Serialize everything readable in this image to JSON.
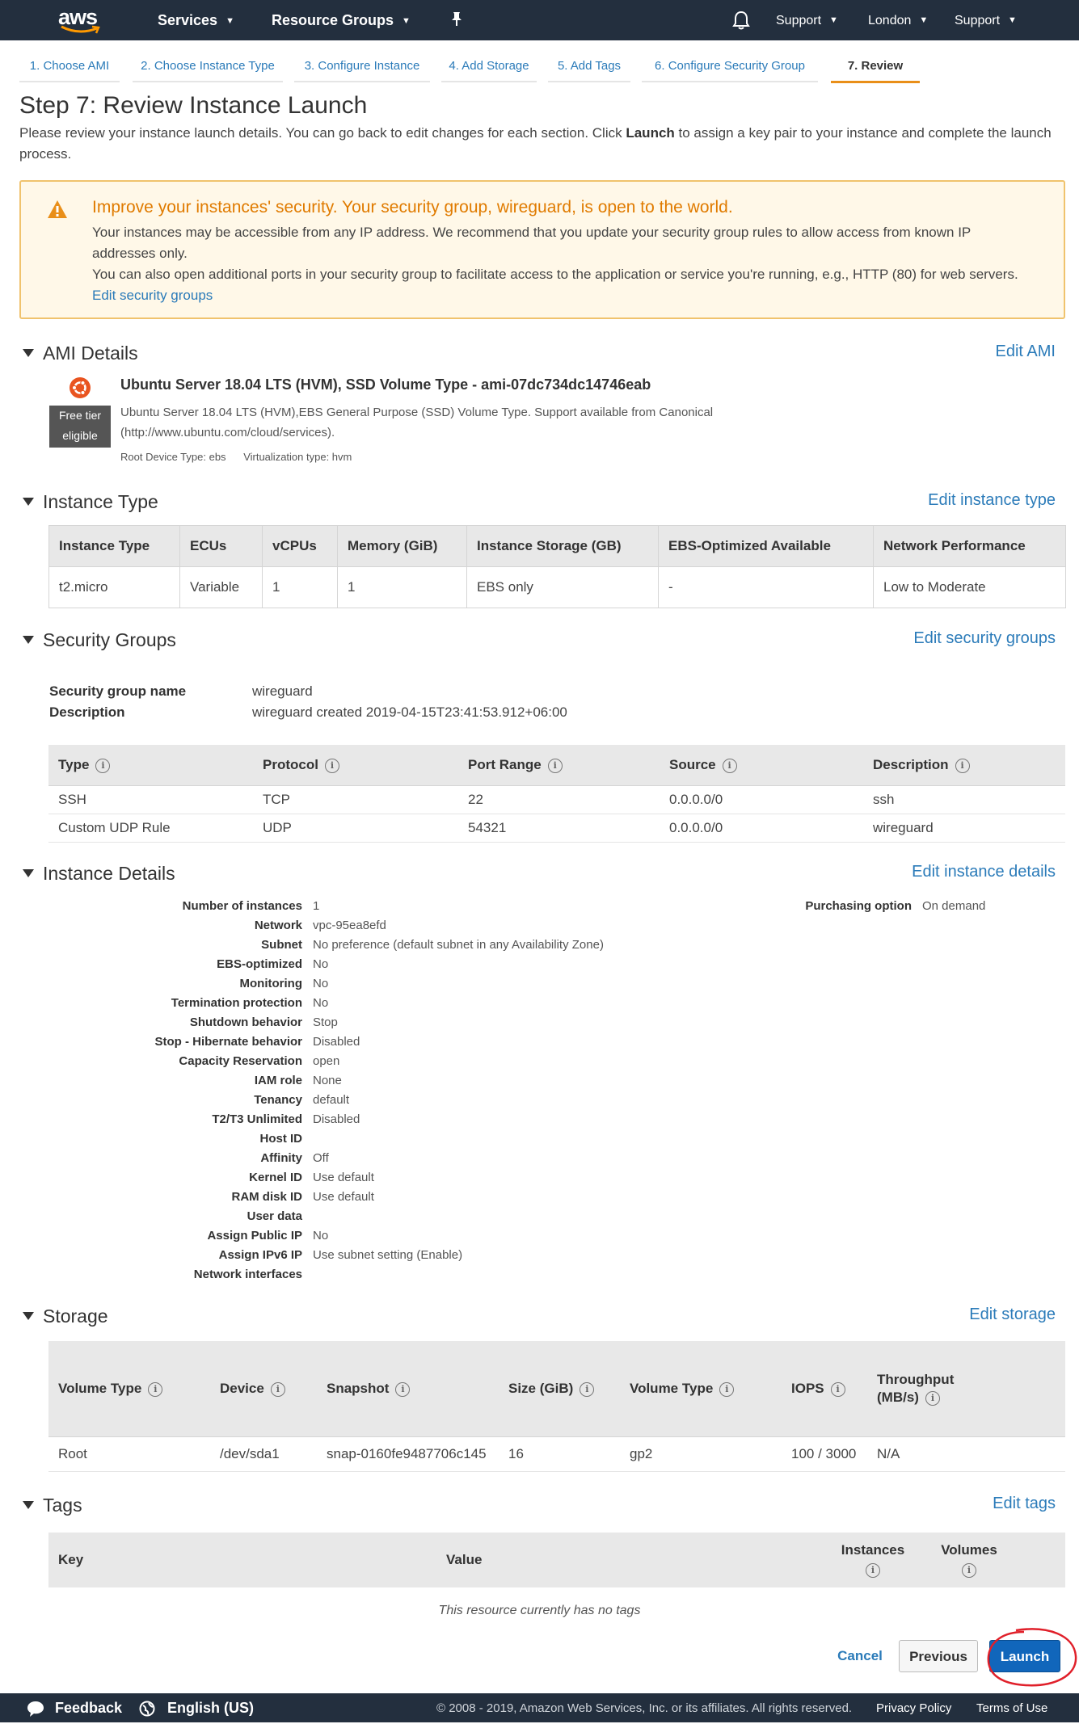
{
  "nav": {
    "logo": "aws",
    "services": "Services",
    "resource_groups": "Resource Groups",
    "account": "Support",
    "region": "London",
    "support": "Support"
  },
  "tabs": [
    "1. Choose AMI",
    "2. Choose Instance Type",
    "3. Configure Instance",
    "4. Add Storage",
    "5. Add Tags",
    "6. Configure Security Group",
    "7. Review"
  ],
  "page": {
    "title": "Step 7: Review Instance Launch",
    "intro_before": "Please review your instance launch details. You can go back to edit changes for each section. Click ",
    "intro_bold": "Launch",
    "intro_after": " to assign a key pair to your instance and complete the launch process."
  },
  "warning": {
    "title": "Improve your instances' security. Your security group, wireguard, is open to the world.",
    "line1": "Your instances may be accessible from any IP address. We recommend that you update your security group rules to allow access from known IP addresses only.",
    "line2": "You can also open additional ports in your security group to facilitate access to the application or service you're running, e.g., HTTP (80) for web servers. ",
    "link": "Edit security groups"
  },
  "ami": {
    "section": "AMI Details",
    "edit": "Edit AMI",
    "badge_line1": "Free tier",
    "badge_line2": "eligible",
    "name": "Ubuntu Server 18.04 LTS (HVM), SSD Volume Type - ami-07dc734dc14746eab",
    "description": "Ubuntu Server 18.04 LTS (HVM),EBS General Purpose (SSD) Volume Type. Support available from Canonical (http://www.ubuntu.com/cloud/services).",
    "root_device": "Root Device Type: ebs",
    "virtualization": "Virtualization type: hvm"
  },
  "instance_type": {
    "section": "Instance Type",
    "edit": "Edit instance type",
    "headers": [
      "Instance Type",
      "ECUs",
      "vCPUs",
      "Memory (GiB)",
      "Instance Storage (GB)",
      "EBS-Optimized Available",
      "Network Performance"
    ],
    "row": [
      "t2.micro",
      "Variable",
      "1",
      "1",
      "EBS only",
      "-",
      "Low to Moderate"
    ]
  },
  "security_groups": {
    "section": "Security Groups",
    "edit": "Edit security groups",
    "name_label": "Security group name",
    "name_value": "wireguard",
    "desc_label": "Description",
    "desc_value": "wireguard created 2019-04-15T23:41:53.912+06:00",
    "headers": [
      "Type",
      "Protocol",
      "Port Range",
      "Source",
      "Description"
    ],
    "rows": [
      [
        "SSH",
        "TCP",
        "22",
        "0.0.0.0/0",
        "ssh"
      ],
      [
        "Custom UDP Rule",
        "UDP",
        "54321",
        "0.0.0.0/0",
        "wireguard"
      ]
    ]
  },
  "instance_details": {
    "section": "Instance Details",
    "edit": "Edit instance details",
    "purchasing_label": "Purchasing option",
    "purchasing_value": "On demand",
    "rows": [
      [
        "Number of instances",
        "1"
      ],
      [
        "Network",
        "vpc-95ea8efd"
      ],
      [
        "Subnet",
        "No preference (default subnet in any Availability Zone)"
      ],
      [
        "EBS-optimized",
        "No"
      ],
      [
        "Monitoring",
        "No"
      ],
      [
        "Termination protection",
        "No"
      ],
      [
        "Shutdown behavior",
        "Stop"
      ],
      [
        "Stop - Hibernate behavior",
        "Disabled"
      ],
      [
        "Capacity Reservation",
        "open"
      ],
      [
        "IAM role",
        "None"
      ],
      [
        "Tenancy",
        "default"
      ],
      [
        "T2/T3 Unlimited",
        "Disabled"
      ],
      [
        "Host ID",
        ""
      ],
      [
        "Affinity",
        "Off"
      ],
      [
        "Kernel ID",
        "Use default"
      ],
      [
        "RAM disk ID",
        "Use default"
      ],
      [
        "User data",
        ""
      ],
      [
        "Assign Public IP",
        "No"
      ],
      [
        "Assign IPv6 IP",
        "Use subnet setting (Enable)"
      ],
      [
        "Network interfaces",
        ""
      ]
    ]
  },
  "storage": {
    "section": "Storage",
    "edit": "Edit storage",
    "headers": [
      "Volume Type",
      "Device",
      "Snapshot",
      "Size (GiB)",
      "Volume Type",
      "IOPS",
      "Throughput (MB/s)"
    ],
    "row": [
      "Root",
      "/dev/sda1",
      "snap-0160fe9487706c145",
      "16",
      "gp2",
      "100 / 3000",
      "N/A"
    ]
  },
  "tags": {
    "section": "Tags",
    "edit": "Edit tags",
    "headers": [
      "Key",
      "Value",
      "Instances",
      "Volumes"
    ],
    "empty": "This resource currently has no tags"
  },
  "actions": {
    "cancel": "Cancel",
    "previous": "Previous",
    "launch": "Launch"
  },
  "footer": {
    "feedback": "Feedback",
    "language": "English (US)",
    "copyright": "© 2008 - 2019, Amazon Web Services, Inc. or its affiliates. All rights reserved.",
    "privacy": "Privacy Policy",
    "terms": "Terms of Use"
  },
  "colors": {
    "nav_bg": "#232f3e",
    "accent_orange": "#e98f19",
    "link_blue": "#2b7bb9",
    "launch_blue": "#1166bb",
    "warning_bg": "#fff8e8",
    "warning_border": "#f0c36d",
    "annotation_red": "#e0202a"
  }
}
